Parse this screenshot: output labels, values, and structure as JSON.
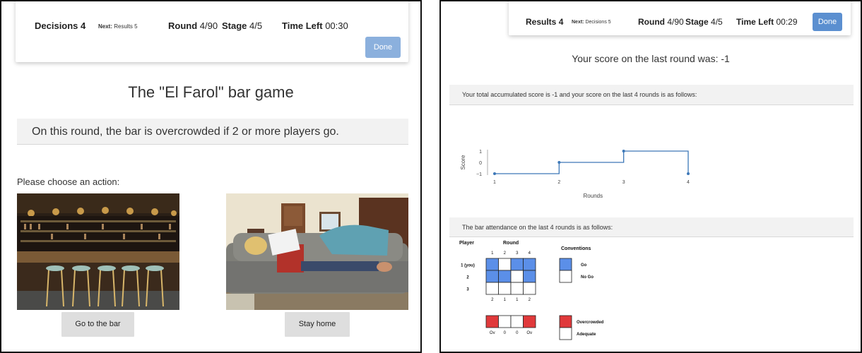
{
  "left": {
    "topbar": {
      "decisions_label": "Decisions",
      "decisions_value": "4",
      "next_label": "Next:",
      "next_value": "Results 5",
      "round_label": "Round",
      "round_value": "4/90",
      "stage_label": "Stage",
      "stage_value": "4/5",
      "time_label": "Time Left",
      "time_value": "00:30",
      "done_label": "Done"
    },
    "title": "The \"El Farol\" bar game",
    "info": "On this round, the bar is overcrowded if 2 or more players go.",
    "prompt": "Please choose an action:",
    "actions": [
      {
        "label": "Go to the bar"
      },
      {
        "label": "Stay home"
      }
    ]
  },
  "right": {
    "topbar": {
      "results_label": "Results",
      "results_value": "4",
      "next_label": "Next:",
      "next_value": "Decisions 5",
      "round_label": "Round",
      "round_value": "4/90",
      "stage_label": "Stage",
      "stage_value": "4/5",
      "time_label": "Time Left",
      "time_value": "00:29",
      "done_label": "Done"
    },
    "last_score": "Your score on the last round was: -1",
    "summary": "Your total accumulated score is -1 and your score on the last 4 rounds is as follows:",
    "attendance_text": "The bar attendance on the last 4 rounds is as follows:"
  },
  "colors": {
    "accent": "#5b8fd0",
    "go": "#5b8fe8",
    "overcrowded": "#e0393b",
    "line": "#3d78b8"
  },
  "chart_data": [
    {
      "type": "line",
      "title": "",
      "xlabel": "Rounds",
      "ylabel": "Score",
      "x": [
        1,
        2,
        3,
        4
      ],
      "y": [
        -1,
        0,
        1,
        -1
      ],
      "step": true,
      "xticks": [
        "1",
        "2",
        "3",
        "4"
      ],
      "yticks": [
        "1",
        "0",
        "−1"
      ],
      "ylim": [
        -1,
        1
      ]
    },
    {
      "type": "heatmap",
      "title": "",
      "player_header": "Player",
      "round_header": "Round",
      "rounds": [
        "1",
        "2",
        "3",
        "4"
      ],
      "players": [
        "1 (you)",
        "2",
        "3"
      ],
      "grid": [
        [
          1,
          0,
          1,
          1
        ],
        [
          1,
          1,
          0,
          1
        ],
        [
          0,
          0,
          0,
          0
        ]
      ],
      "totals": [
        "2",
        "1",
        "1",
        "2"
      ],
      "status": [
        1,
        0,
        0,
        1
      ],
      "status_labels": [
        "Ov",
        "0",
        "0",
        "Ov"
      ],
      "legend_title": "Conventions",
      "legend": [
        "Go",
        "No Go",
        "Overcrowded",
        "Adequate"
      ]
    }
  ]
}
